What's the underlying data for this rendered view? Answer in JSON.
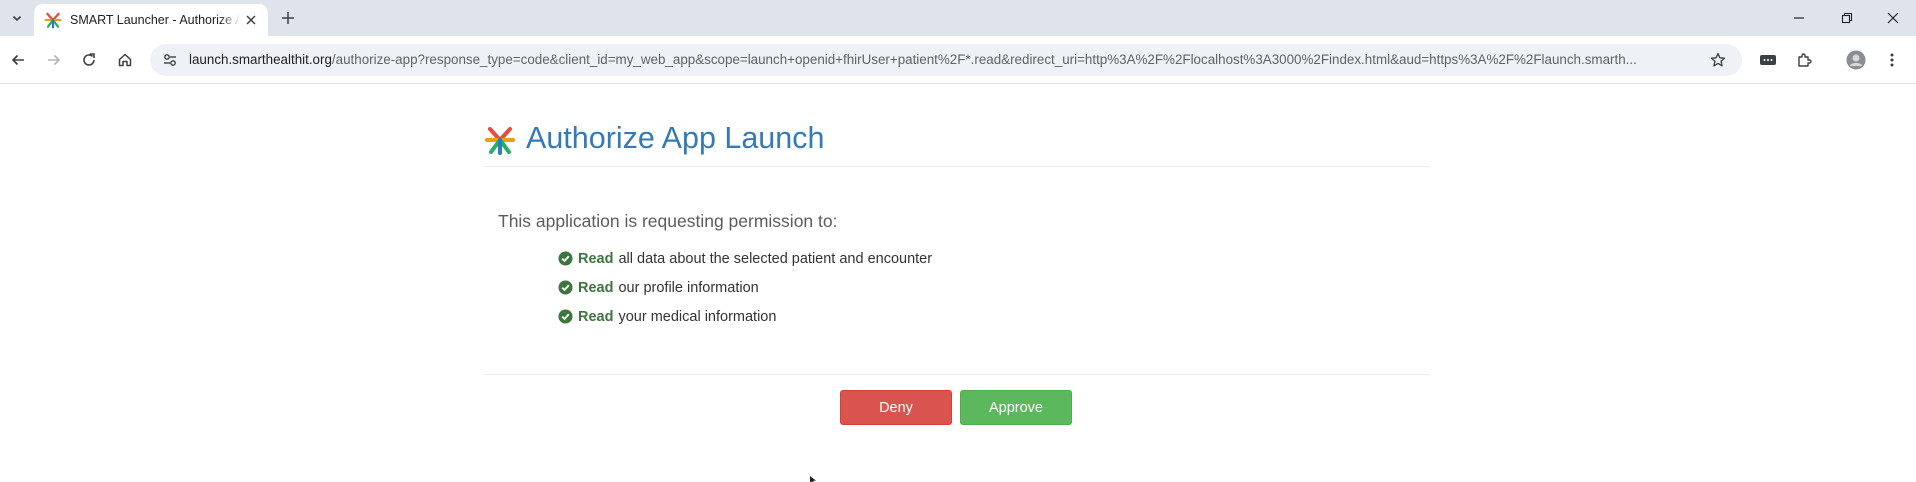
{
  "browser": {
    "tab": {
      "title": "SMART Launcher - Authorize App Launch",
      "favicon": "smart-logo-icon"
    },
    "address_bar": {
      "host": "launch.smarthealthit.org",
      "path": "/authorize-app?response_type=code&client_id=my_web_app&scope=launch+openid+fhirUser+patient%2F*.read&redirect_uri=http%3A%2F%2Flocalhost%3A3000%2Findex.html&aud=https%3A%2F%2Flaunch.smarth..."
    }
  },
  "page": {
    "title": "Authorize App Launch",
    "lead": "This application is requesting permission to:",
    "permissions": [
      {
        "verb": "Read",
        "text": "all data about the selected patient and encounter"
      },
      {
        "verb": "Read",
        "text": "our profile information"
      },
      {
        "verb": "Read",
        "text": "your medical information"
      }
    ],
    "buttons": {
      "deny": "Deny",
      "approve": "Approve"
    }
  },
  "colors": {
    "title_blue": "#337ab7",
    "permission_green": "#3c763d",
    "deny_red": "#d9534f",
    "approve_green": "#5cb85c",
    "tabstrip_bg": "#dfe3eb"
  }
}
